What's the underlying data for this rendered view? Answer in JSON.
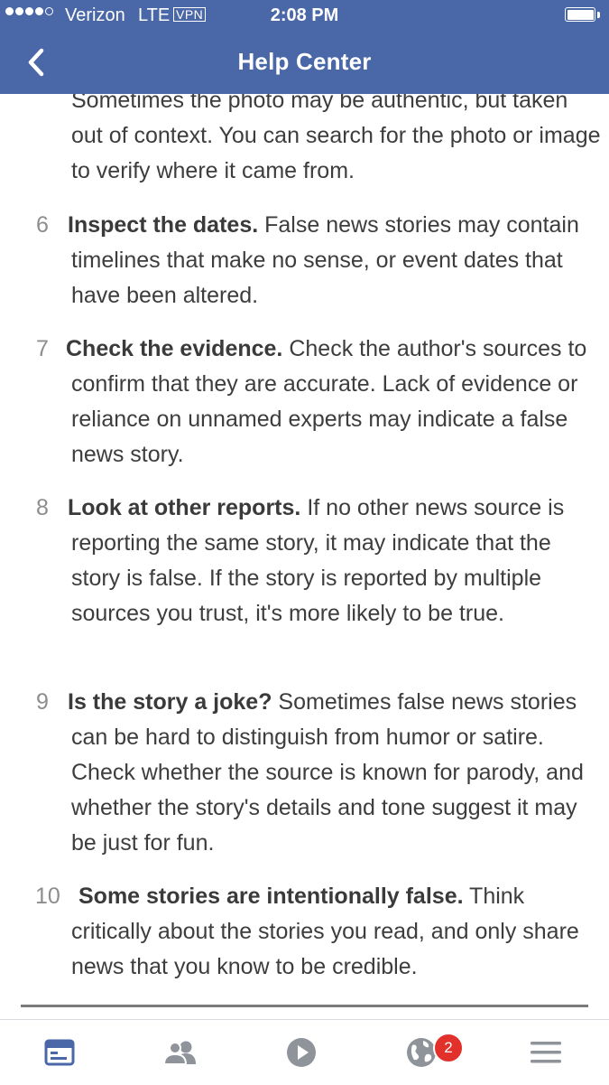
{
  "status_bar": {
    "carrier": "Verizon",
    "network": "LTE",
    "vpn": "VPN",
    "time": "2:08 PM",
    "signal_bars": 4,
    "signal_max": 5,
    "battery_level": 1.0
  },
  "nav": {
    "title": "Help Center",
    "back_icon": "chevron-left-icon"
  },
  "article": {
    "intro_fragment": "Sometimes the photo may be authentic, but taken out of context. You can search for the photo or image to verify where it came from.",
    "steps": [
      {
        "number": "6",
        "title": "Inspect the dates.",
        "text": "False news stories may contain timelines that make no sense, or event dates that have been altered."
      },
      {
        "number": "7",
        "title": "Check the evidence.",
        "text": "Check the author's sources to confirm that they are accurate. Lack of evidence or reliance on unnamed experts may indicate a false news story."
      },
      {
        "number": "8",
        "title": "Look at other reports.",
        "text": "If no other news source is reporting the same story, it may indicate that the story is false. If the story is reported by multiple sources you trust, it's more likely to be true."
      },
      {
        "number": "9",
        "title": "Is the story a joke?",
        "text": "Sometimes false news stories can be hard to distinguish from humor or satire. Check whether the source is known for parody, and whether the story's details and tone suggest it may be just for fun."
      },
      {
        "number": "10",
        "title": "Some stories are intentionally false.",
        "text": "Think critically about the stories you read, and only share news that you know to be credible."
      }
    ]
  },
  "tab_bar": {
    "tabs": [
      {
        "icon": "news-feed-icon",
        "active": true
      },
      {
        "icon": "friends-icon",
        "active": false
      },
      {
        "icon": "video-play-icon",
        "active": false
      },
      {
        "icon": "globe-notifications-icon",
        "active": false
      },
      {
        "icon": "hamburger-menu-icon",
        "active": false
      }
    ],
    "notification_count": "2"
  },
  "colors": {
    "header_bg": "#4a67a8",
    "active_tab": "#4a67a8",
    "inactive_tab": "#8f949b",
    "badge": "#e2302b"
  }
}
